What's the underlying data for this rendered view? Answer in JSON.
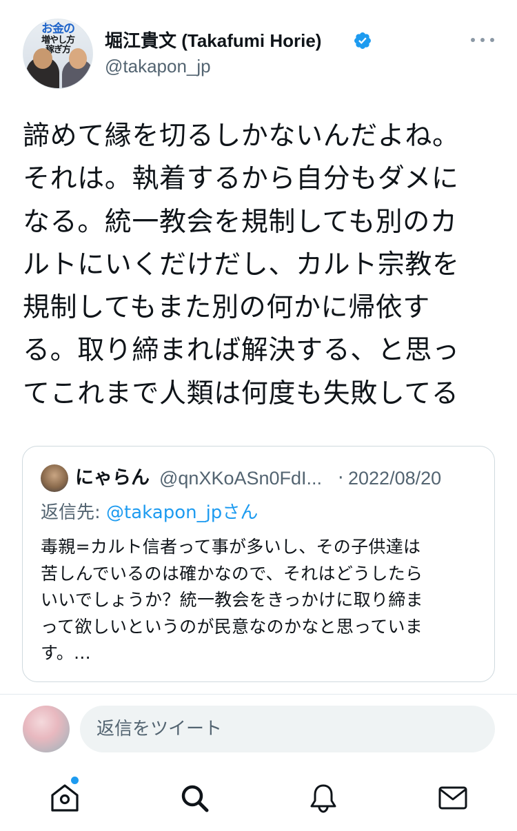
{
  "author": {
    "display_name": "堀江貴文 (Takafumi Horie)",
    "handle": "@takapon_jp",
    "verified": true,
    "avatar_title": "お金の",
    "avatar_subtitle": "増やし方\n稼ぎ方"
  },
  "tweet": {
    "text_lines": [
      "諦めて縁を切るしかないんだよね。",
      "それは。執着するから自分もダメに",
      "なる。統一教会を規制しても別のカ",
      "ルトにいくだけだし、カルト宗教を",
      "規制してもまた別の何かに帰依す",
      "る。取り締まれば解決する、と思っ",
      "てこれまで人類は何度も失敗してる"
    ]
  },
  "quoted_tweet": {
    "display_name": "にゃらん",
    "handle": "@qnXKoASn0FdI...",
    "separator": "·",
    "date": "2022/08/20",
    "reply_prefix": "返信先: ",
    "reply_mention": "@takapon_jp",
    "reply_suffix": "さん",
    "text_lines": [
      "毒親=カルト信者って事が多いし、その子供達は",
      "苦しんでいるのは確かなので、それはどうしたら",
      "いいでしょうか？統一教会をきっかけに取り締ま",
      "って欲しいというのが民意なのかなと思っていま",
      "す。..."
    ]
  },
  "reply_bar": {
    "placeholder": "返信をツイート"
  },
  "tab_bar": {
    "items": [
      "home-icon",
      "search-icon",
      "notifications-icon",
      "messages-icon"
    ],
    "home_has_badge": true,
    "badge_color": "#1d9bf0"
  },
  "colors": {
    "accent": "#1d9bf0",
    "text": "#0f1419",
    "secondary": "#536471",
    "border": "#cfd9de"
  }
}
